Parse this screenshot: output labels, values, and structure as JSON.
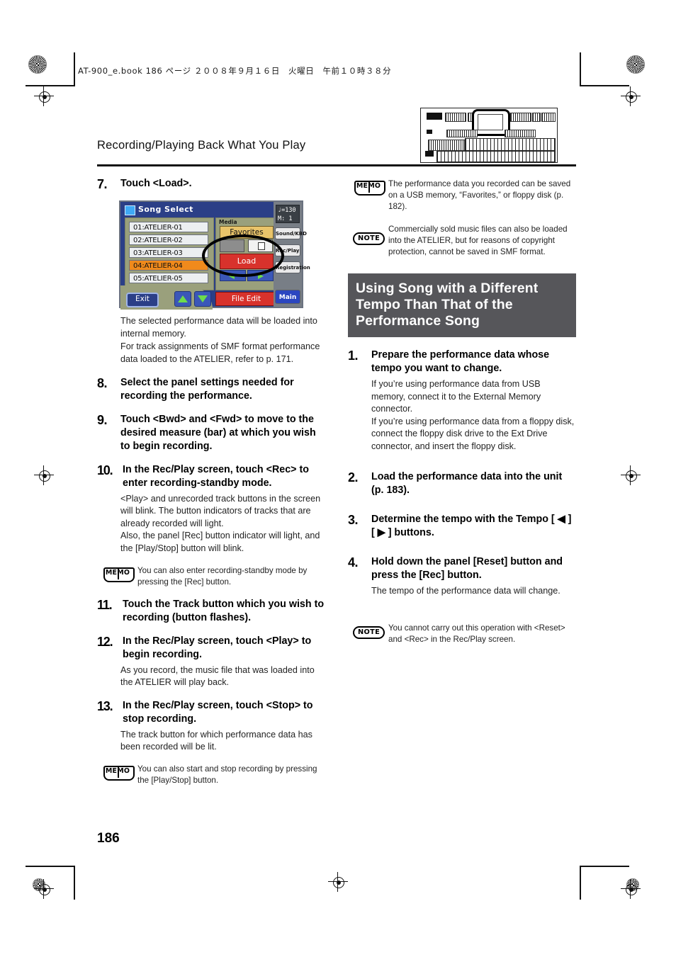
{
  "file_header": "AT-900_e.book  186 ページ  ２００８年９月１６日　火曜日　午前１０時３８分",
  "running_head": "Recording/Playing Back What You Play",
  "page_number": "186",
  "colors": {
    "banner_bg": "#56565a",
    "lcd_bg": "#2b3f87",
    "lcd_panel": "#9aa07c",
    "selected_song": "#f08a1c",
    "red_button": "#d8322c",
    "favorites_button": "#e9c46a",
    "blue_button": "#3b57b8",
    "main_button": "#2b46c0"
  },
  "lcd": {
    "title": "Song Select",
    "title_icon": "song-select-icon",
    "songs": [
      {
        "label": "01:ATELIER-01",
        "selected": false
      },
      {
        "label": "02:ATELIER-02",
        "selected": false
      },
      {
        "label": "03:ATELIER-03",
        "selected": false
      },
      {
        "label": "04:ATELIER-04",
        "selected": true
      },
      {
        "label": "05:ATELIER-05",
        "selected": false
      }
    ],
    "media_label": "Media",
    "favorites_label": "Favorites",
    "usb_icon": "usb-memory-icon",
    "floppy_icon": "floppy-disk-icon",
    "load_label": "Load",
    "bwd_icon": "rewind-icon",
    "fwd_icon": "forward-icon",
    "file_edit_label": "File Edit",
    "exit_label": "Exit",
    "up_icon": "up-arrow-icon",
    "down_icon": "down-arrow-icon",
    "tempo_value": "♩=130",
    "measure_value": "M:    1",
    "side_buttons": [
      {
        "label": "Sound/KBD",
        "icon": "note-icon"
      },
      {
        "label": "Rec/Play",
        "icon": "speaker-icon"
      },
      {
        "label": "Registration",
        "icon": "registration-icon"
      }
    ],
    "main_label": "Main",
    "highlight_ellipse": "load-button-highlight-ellipse"
  },
  "left_column": {
    "step7": {
      "num": "7.",
      "title": "Touch <Load>.",
      "sub": "The selected performance data will be loaded into internal memory.\nFor track assignments of SMF format performance data loaded to the ATELIER, refer to p. 171."
    },
    "step8": {
      "num": "8.",
      "title": "Select the panel settings needed for recording the performance."
    },
    "step9": {
      "num": "9.",
      "title": "Touch <Bwd> and <Fwd> to move to the desired measure (bar) at which you wish to begin recording."
    },
    "step10": {
      "num": "10.",
      "title": "In the Rec/Play screen, touch <Rec> to enter recording-standby mode.",
      "sub": "<Play> and unrecorded track buttons in the screen will blink. The button indicators of tracks that are already recorded will light.\nAlso, the panel [Rec] button indicator will light, and the [Play/Stop] button will blink.",
      "memo": "You can also enter recording-standby mode by pressing the [Rec] button."
    },
    "step11": {
      "num": "11.",
      "title": "Touch the Track button which you wish to recording (button flashes)."
    },
    "step12": {
      "num": "12.",
      "title": "In the Rec/Play screen, touch <Play> to begin recording.",
      "sub": "As you record, the music file that was loaded into the ATELIER will play back."
    },
    "step13": {
      "num": "13.",
      "title": "In the Rec/Play screen, touch <Stop> to stop recording.",
      "sub": "The track button for which performance data has been recorded will be lit.",
      "memo": "You can also start and stop recording by pressing the [Play/Stop] button."
    }
  },
  "right_column": {
    "memo_top": "The performance data you recorded can be saved on a USB memory, “Favorites,” or floppy disk (p. 182).",
    "note_top": "Commercially sold music files can also be loaded into the ATELIER, but for reasons of copyright protection, cannot be saved in SMF format.",
    "banner": "Using Song with a Different Tempo Than That of the Performance Song",
    "step1": {
      "num": "1.",
      "title": "Prepare the performance data whose tempo you want to change.",
      "sub": "If you’re using performance data from USB memory, connect it to the External Memory connector.\nIf you’re using performance data from a floppy disk, connect the floppy disk drive to the Ext Drive connector, and insert the floppy disk."
    },
    "step2": {
      "num": "2.",
      "title": "Load the performance data into the unit (p. 183)."
    },
    "step3": {
      "num": "3.",
      "title": "Determine the tempo with the Tempo [ ◀ ] [ ▶ ] buttons."
    },
    "step4": {
      "num": "4.",
      "title": "Hold down the panel [Reset] button and press the [Rec] button.",
      "sub": "The tempo of the performance data will change."
    },
    "note_bottom": "You cannot carry out this operation with <Reset> and <Rec> in the Rec/Play screen."
  },
  "labels": {
    "memo_tag": "MEMO",
    "note_tag": "NOTE"
  }
}
